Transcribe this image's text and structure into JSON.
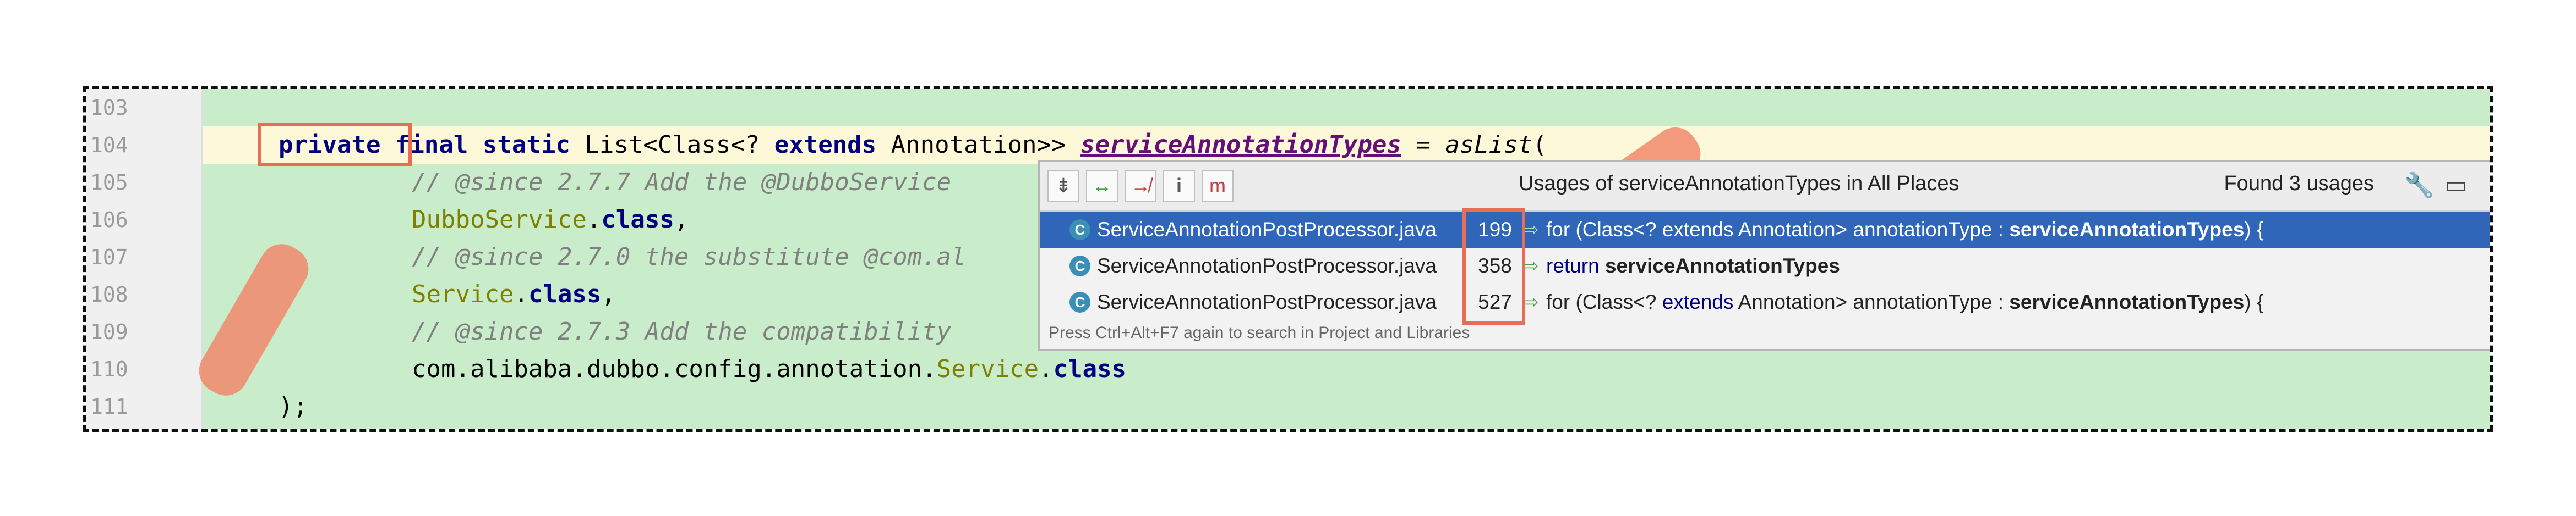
{
  "lines": [
    {
      "num": "103",
      "code": ""
    },
    {
      "num": "104",
      "code": "private final static List<Class<? extends Annotation>> serviceAnnotationTypes = asList("
    },
    {
      "num": "105",
      "code": "// @since 2.7.7 Add the @DubboService"
    },
    {
      "num": "106",
      "code": "DubboService.class,"
    },
    {
      "num": "107",
      "code": "// @since 2.7.0 the substitute @com.al"
    },
    {
      "num": "108",
      "code": "Service.class,"
    },
    {
      "num": "109",
      "code": "// @since 2.7.3 Add the compatibility"
    },
    {
      "num": "110",
      "code": "com.alibaba.dubbo.config.annotation.Service.class"
    },
    {
      "num": "111",
      "code": ");"
    }
  ],
  "code104": {
    "private": "private",
    "final": "final",
    "static": "static",
    "list": "List<Class<? ",
    "extends": "extends",
    "annotation": " Annotation>> ",
    "field": "serviceAnnotationTypes",
    "eq": " = ",
    "aslist": "asList",
    "paren": "("
  },
  "code105": "// @since 2.7.7 Add the @DubboService",
  "code106": {
    "cls": "DubboService",
    "dot": ".",
    "kw": "class",
    "end": ","
  },
  "code107": "// @since 2.7.0 the substitute @com.al",
  "code108": {
    "cls": "Service",
    "dot": ".",
    "kw": "class",
    "end": ","
  },
  "code109": "// @since 2.7.3 Add the compatibility",
  "code110": {
    "pkg": "com.alibaba.dubbo.config.annotation.",
    "cls": "Service",
    "dot": ".",
    "kw": "class"
  },
  "code111": ");",
  "popup": {
    "title": "Usages of serviceAnnotationTypes in All Places",
    "found": "Found 3 usages",
    "hint": "Press Ctrl+Alt+F7 again to search in Project and Libraries",
    "toolbar": [
      "⇟",
      "↔",
      "↛",
      "i",
      "m"
    ],
    "rows": [
      {
        "file": "ServiceAnnotationPostProcessor.java",
        "line": "199",
        "pre": "for (Class<? ",
        "kw": "extends",
        "mid": " Annotation> annotationType : ",
        "bold": "serviceAnnotationTypes",
        "post": ") {"
      },
      {
        "file": "ServiceAnnotationPostProcessor.java",
        "line": "358",
        "pre": "return ",
        "kw": "",
        "mid": "",
        "bold": "serviceAnnotationTypes",
        "post": ""
      },
      {
        "file": "ServiceAnnotationPostProcessor.java",
        "line": "527",
        "pre": "for (Class<? ",
        "kw": "extends",
        "mid": " Annotation> annotationType : ",
        "bold": "serviceAnnotationTypes",
        "post": ") {"
      }
    ]
  }
}
